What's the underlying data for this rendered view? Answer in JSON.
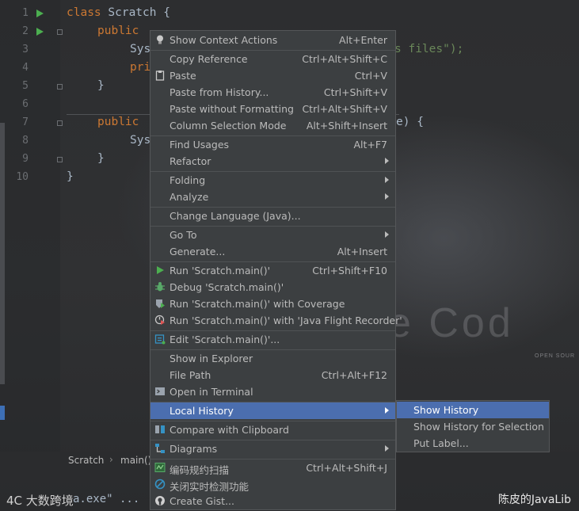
{
  "colors": {
    "menu_bg": "#3c3f41",
    "highlight": "#4b6eaf",
    "keyword": "#cc7832",
    "string": "#6a8759",
    "code_text": "#a9b7c6",
    "run_icon": "#4caf50"
  },
  "editor": {
    "line_numbers": [
      "1",
      "2",
      "3",
      "4",
      "5",
      "6",
      "7",
      "8",
      "9",
      "10"
    ],
    "code": {
      "l1_kw": "class",
      "l1_rest": " Scratch {",
      "l2_kw": "public",
      "l3_pre": "Sys",
      "l3_str": "s files\");",
      "l4_pre": "pri",
      "l5_brace": "}",
      "l7_kw": "public",
      "l7_rest": "e) {",
      "l8_pre": "Sys",
      "l9_brace": "}",
      "l10_brace": "}"
    },
    "watermark": {
      "big_text": "e  Cod",
      "open_source": "OPEN SOUR"
    }
  },
  "breadcrumb": {
    "items": [
      "Scratch",
      "main()"
    ]
  },
  "bottom": {
    "code_fragment": "a.exe\" ...",
    "left_brand": "4C 大数跨境",
    "right_brand": "陈皮的JavaLib"
  },
  "context_menu": {
    "items": [
      {
        "label": "Show Context Actions",
        "shortcut": "Alt+Enter",
        "icon": "lightbulb-icon"
      },
      {
        "label": "Copy Reference",
        "shortcut": "Ctrl+Alt+Shift+C"
      },
      {
        "label": "Paste",
        "shortcut": "Ctrl+V",
        "icon": "clipboard-icon"
      },
      {
        "label": "Paste from History...",
        "shortcut": "Ctrl+Shift+V"
      },
      {
        "label": "Paste without Formatting",
        "shortcut": "Ctrl+Alt+Shift+V"
      },
      {
        "label": "Column Selection Mode",
        "shortcut": "Alt+Shift+Insert"
      },
      {
        "label": "Find Usages",
        "shortcut": "Alt+F7"
      },
      {
        "label": "Refactor",
        "submenu": true
      },
      {
        "label": "Folding",
        "submenu": true
      },
      {
        "label": "Analyze",
        "submenu": true
      },
      {
        "label": "Change Language (Java)..."
      },
      {
        "label": "Go To",
        "submenu": true
      },
      {
        "label": "Generate...",
        "shortcut": "Alt+Insert"
      },
      {
        "label": "Run 'Scratch.main()'",
        "shortcut": "Ctrl+Shift+F10",
        "icon": "run-icon"
      },
      {
        "label": "Debug 'Scratch.main()'",
        "icon": "debug-icon"
      },
      {
        "label": "Run 'Scratch.main()' with Coverage",
        "icon": "coverage-icon"
      },
      {
        "label": "Run 'Scratch.main()' with 'Java Flight Recorder'",
        "icon": "profiler-icon"
      },
      {
        "label": "Edit 'Scratch.main()'...",
        "icon": "edit-config-icon"
      },
      {
        "label": "Show in Explorer"
      },
      {
        "label": "File Path",
        "shortcut": "Ctrl+Alt+F12"
      },
      {
        "label": "Open in Terminal",
        "icon": "terminal-icon"
      },
      {
        "label": "Local History",
        "submenu": true,
        "highlighted": true
      },
      {
        "label": "Compare with Clipboard",
        "icon": "compare-icon"
      },
      {
        "label": "Diagrams",
        "submenu": true,
        "icon": "diagram-icon"
      },
      {
        "label": "编码规约扫描",
        "shortcut": "Ctrl+Alt+Shift+J",
        "icon": "scan-icon"
      },
      {
        "label": "关闭实时检测功能",
        "icon": "disable-icon"
      },
      {
        "label": "Create Gist...",
        "icon": "github-icon"
      }
    ]
  },
  "local_history_submenu": {
    "items": [
      {
        "label": "Show History",
        "highlighted": true
      },
      {
        "label": "Show History for Selection"
      },
      {
        "label": "Put Label..."
      }
    ]
  }
}
